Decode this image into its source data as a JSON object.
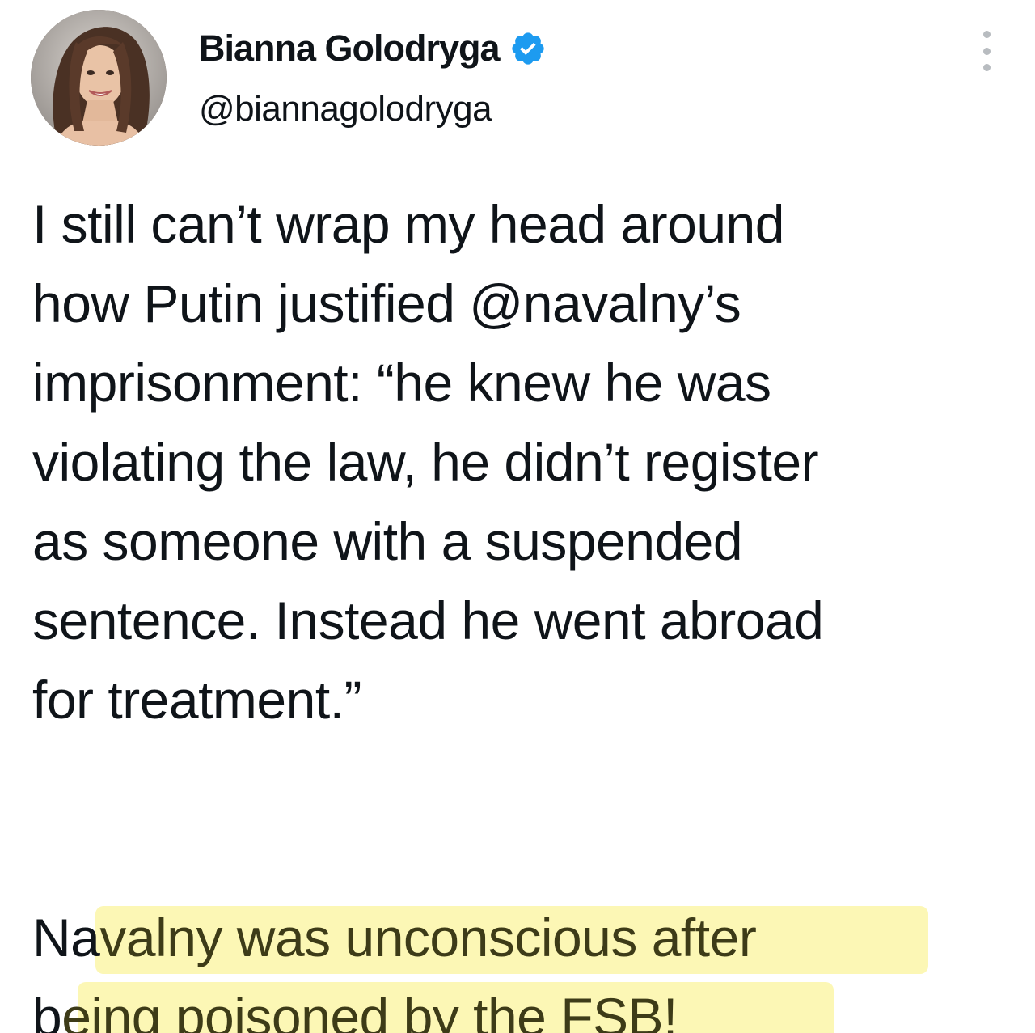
{
  "user": {
    "display_name": "Bianna Golodryga",
    "handle": "@biannagolodryga",
    "verified": true
  },
  "icons": {
    "avatar": "profile-photo",
    "verified": "verified-badge-icon",
    "more": "more-vertical-icon"
  },
  "colors": {
    "text": "#0f1419",
    "verified_blue": "#1d9bf0",
    "highlight": "#f7ef86",
    "muted_icon": "#b8bcc0"
  },
  "tweet": {
    "lines": [
      "I still can’t wrap my head around",
      "how Putin justified @navalny’s",
      "imprisonment: “he knew he was",
      "violating the law, he didn’t register",
      "as someone with a suspended",
      "sentence. Instead he went abroad",
      "for treatment.”"
    ],
    "highlight_line1_pre": "Na",
    "highlight_line1_mark": "valny was unconscious after",
    "highlight_line2_pre": "b",
    "highlight_line2_mark": "eing poisoned by the FSB!"
  }
}
